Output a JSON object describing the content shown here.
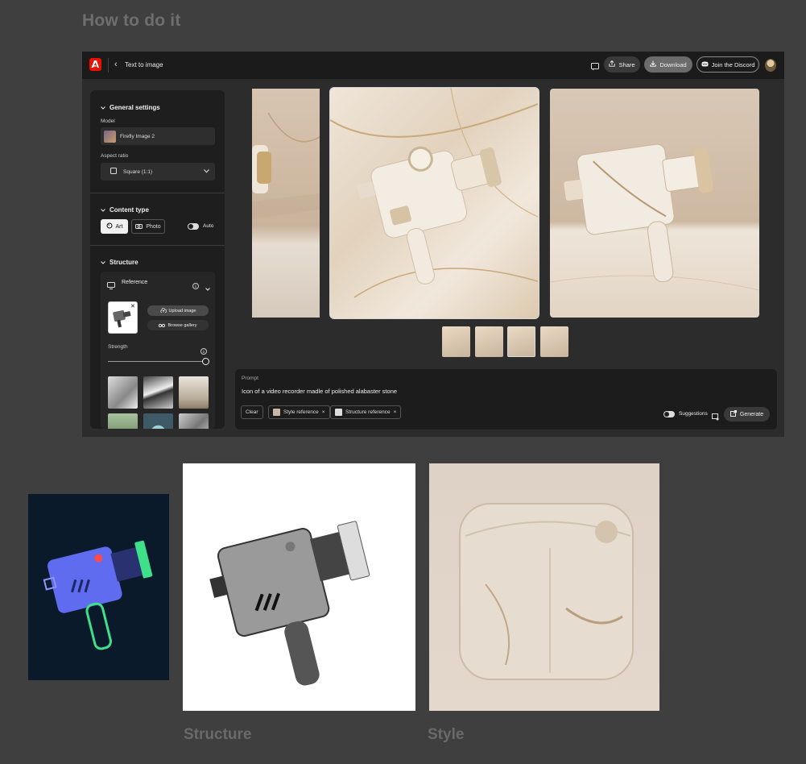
{
  "page": {
    "heading": "How to do it",
    "captions": {
      "structure": "Structure",
      "style": "Style"
    }
  },
  "app": {
    "topbar": {
      "back_label": "‹",
      "breadcrumb": "Text to image",
      "share_label": "Share",
      "download_label": "Download",
      "discord_label": "Join the Discord"
    },
    "sidebar": {
      "general": {
        "title": "General settings",
        "model_label": "Model",
        "model_value": "Firefly Image 2",
        "aspect_label": "Aspect ratio",
        "aspect_value": "Square (1:1)"
      },
      "content_type": {
        "title": "Content type",
        "art_label": "Art",
        "photo_label": "Photo",
        "auto_label": "Auto"
      },
      "structure": {
        "title": "Structure",
        "reference_label": "Reference",
        "upload_label": "Upload image",
        "browse_label": "Browse gallery",
        "strength_label": "Strength",
        "strength_value": 1.0
      }
    },
    "prompt": {
      "label": "Prompt",
      "text": "Icon of a video recorder madle of polished alabaster stone",
      "clear_label": "Clear",
      "style_ref_label": "Style reference",
      "structure_ref_label": "Structure reference",
      "suggestions_label": "Suggestions",
      "generate_label": "Generate"
    }
  },
  "colors": {
    "accent_red": "#eb1000",
    "app_bg": "#2c2c2c",
    "page_bg": "#3f3f3f"
  },
  "icons": [
    "adobe-logo-icon",
    "chevron-left-icon",
    "chat-icon",
    "share-icon",
    "download-icon",
    "discord-icon",
    "chevron-down-icon",
    "square-icon",
    "art-icon",
    "camera-icon",
    "reference-icon",
    "info-icon",
    "upload-icon",
    "binoculars-icon",
    "close-icon",
    "generate-icon",
    "suggestions-icon"
  ]
}
